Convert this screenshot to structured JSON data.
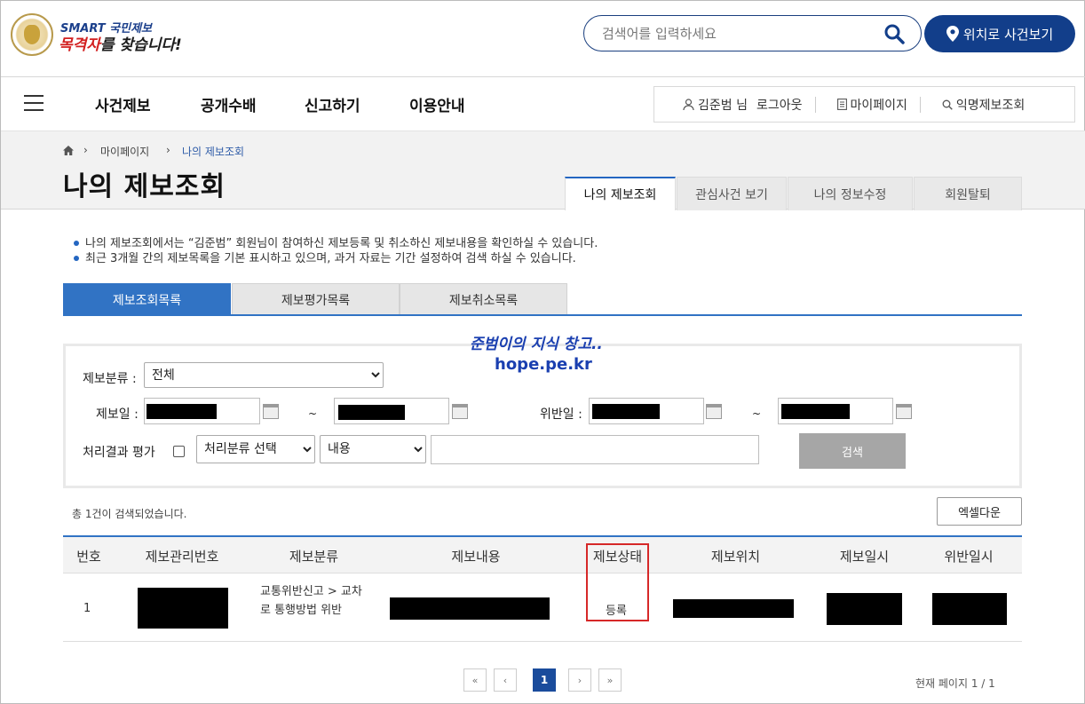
{
  "header": {
    "logo_top": "SMART 국민제보",
    "logo_bottom_red": "목격자",
    "logo_bottom_rest": "를 찾습니다!",
    "search_placeholder": "검색어를 입력하세요",
    "location_button": "위치로 사건보기"
  },
  "nav": {
    "items": [
      "사건제보",
      "공개수배",
      "신고하기",
      "이용안내"
    ],
    "user": "김준범 님",
    "logout": "로그아웃",
    "mypage": "마이페이지",
    "anonymous": "익명제보조회"
  },
  "breadcrumb": {
    "level1": "마이페이지",
    "level2": "나의 제보조회"
  },
  "page_title": "나의 제보조회",
  "page_tabs": [
    "나의 제보조회",
    "관심사건 보기",
    "나의 정보수정",
    "회원탈퇴"
  ],
  "notice": [
    "나의 제보조회에서는 “김준범” 회원님이 참여하신 제보등록 및 취소하신 제보내용을 확인하실 수 있습니다.",
    "최근 3개월 간의 제보목록을 기본 표시하고 있으며, 과거 자료는 기간 설정하여 검색 하실 수 있습니다."
  ],
  "sub_tabs": [
    "제보조회목록",
    "제보평가목록",
    "제보취소목록"
  ],
  "watermark": {
    "line1": "준범이의 지식 창고..",
    "line2": "hope.pe.kr"
  },
  "filter": {
    "category_label": "제보분류 :",
    "category_value": "전체",
    "report_date_label": "제보일 :",
    "tilde": "~",
    "violation_date_label": "위반일 :",
    "eval_label": "처리결과 평가",
    "process_select": "처리분류 선택",
    "content_select": "내용",
    "search_button": "검색"
  },
  "result": {
    "total_text": "총 1건이 검색되었습니다.",
    "excel_button": "엑셀다운",
    "columns": [
      "번호",
      "제보관리번호",
      "제보분류",
      "제보내용",
      "제보상태",
      "제보위치",
      "제보일시",
      "위반일시"
    ],
    "row": {
      "no": "1",
      "category": "교통위반신고 > 교차로 통행방법 위반",
      "status": "등록"
    }
  },
  "pager": {
    "current": "1",
    "info": "현재 페이지 1 / 1"
  },
  "colors": {
    "primary": "#123e8a",
    "tab_blue": "#3173c4",
    "highlight_red": "#d62828"
  }
}
